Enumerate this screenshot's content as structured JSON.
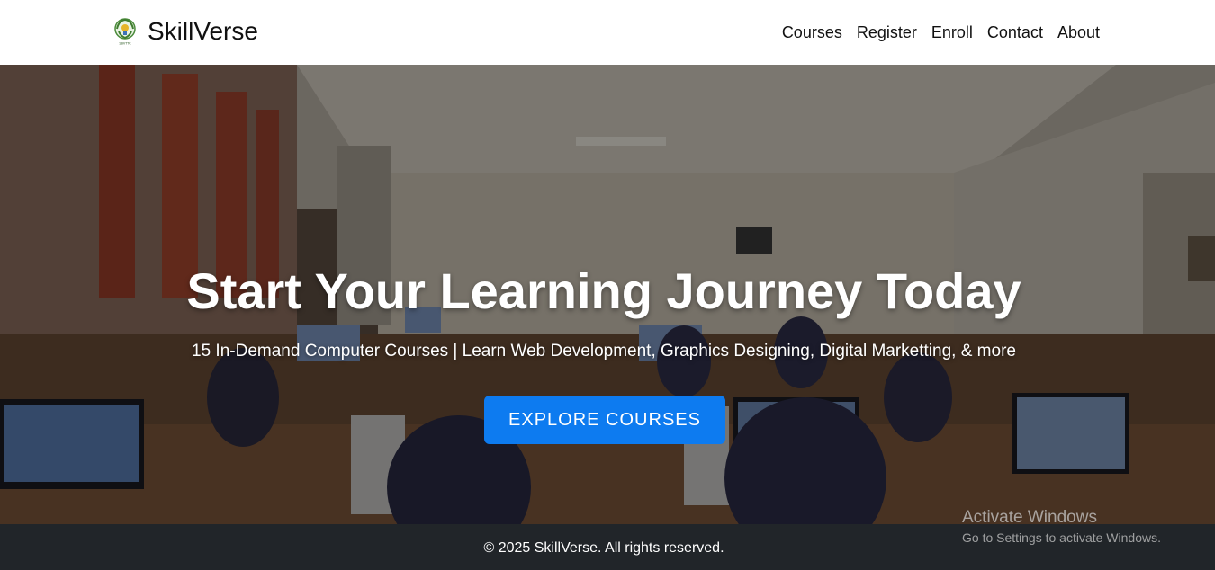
{
  "header": {
    "brand": "SkillVerse",
    "logo_caption": "SBVTTC",
    "nav": [
      "Courses",
      "Register",
      "Enroll",
      "Contact",
      "About"
    ]
  },
  "hero": {
    "title": "Start Your Learning Journey Today",
    "subtitle": "15 In-Demand Computer Courses | Learn Web Development, Graphics Designing, Digital Marketting, & more",
    "cta_label": "EXPLORE COURSES"
  },
  "footer": {
    "copyright": "© 2025 SkillVerse. All rights reserved."
  },
  "watermark": {
    "title": "Activate Windows",
    "subtitle": "Go to Settings to activate Windows."
  },
  "colors": {
    "accent": "#0d7bf0",
    "footer_bg": "#212529",
    "header_bg": "#ffffff"
  },
  "icons": {
    "logo": "emblem-icon"
  }
}
